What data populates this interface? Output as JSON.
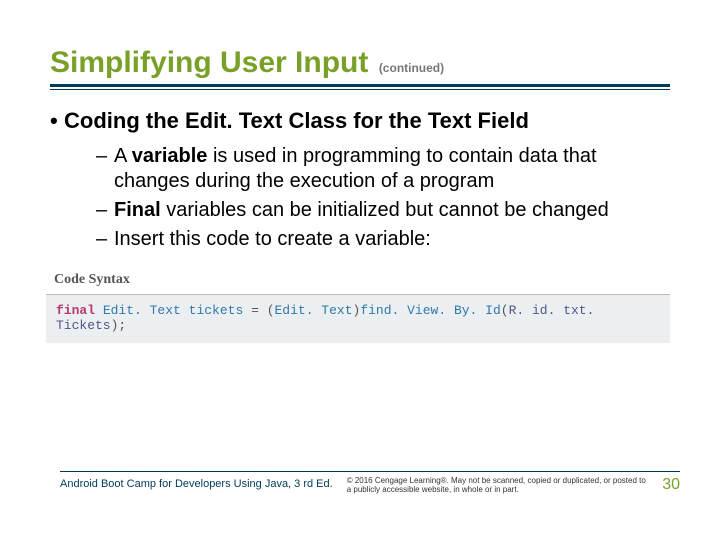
{
  "title": {
    "main": "Simplifying User Input",
    "continued": "(continued)"
  },
  "heading_bullet": "Coding the Edit. Text Class for the Text Field",
  "sub_items": [
    {
      "dash": "–",
      "pre": "A ",
      "key": "variable",
      "post": " is used in programming to contain data that changes during the execution of a program"
    },
    {
      "dash": "–",
      "pre": "",
      "key": "Final",
      "post": " variables can be initialized but cannot be changed"
    },
    {
      "dash": "–",
      "pre": "",
      "key": "",
      "post": "Insert this code to create a variable:"
    }
  ],
  "code_label": "Code Syntax",
  "code": {
    "kw": "final",
    "type1": "Edit. Text",
    "var": "tickets",
    "eq": " = ",
    "cast_open": "(",
    "type2": "Edit. Text",
    "cast_close": ")",
    "fn": "find. View. By. Id",
    "paren_open": "(",
    "ns": "R. id.",
    "member": " txt. Tickets",
    "paren_close": ");"
  },
  "footer": {
    "book": "Android Boot Camp for Developers Using Java, 3 rd Ed.",
    "legal": "© 2016 Cengage Learning®. May not be scanned, copied or duplicated, or posted to a publicly accessible website, in whole or in part.",
    "page": "30"
  }
}
